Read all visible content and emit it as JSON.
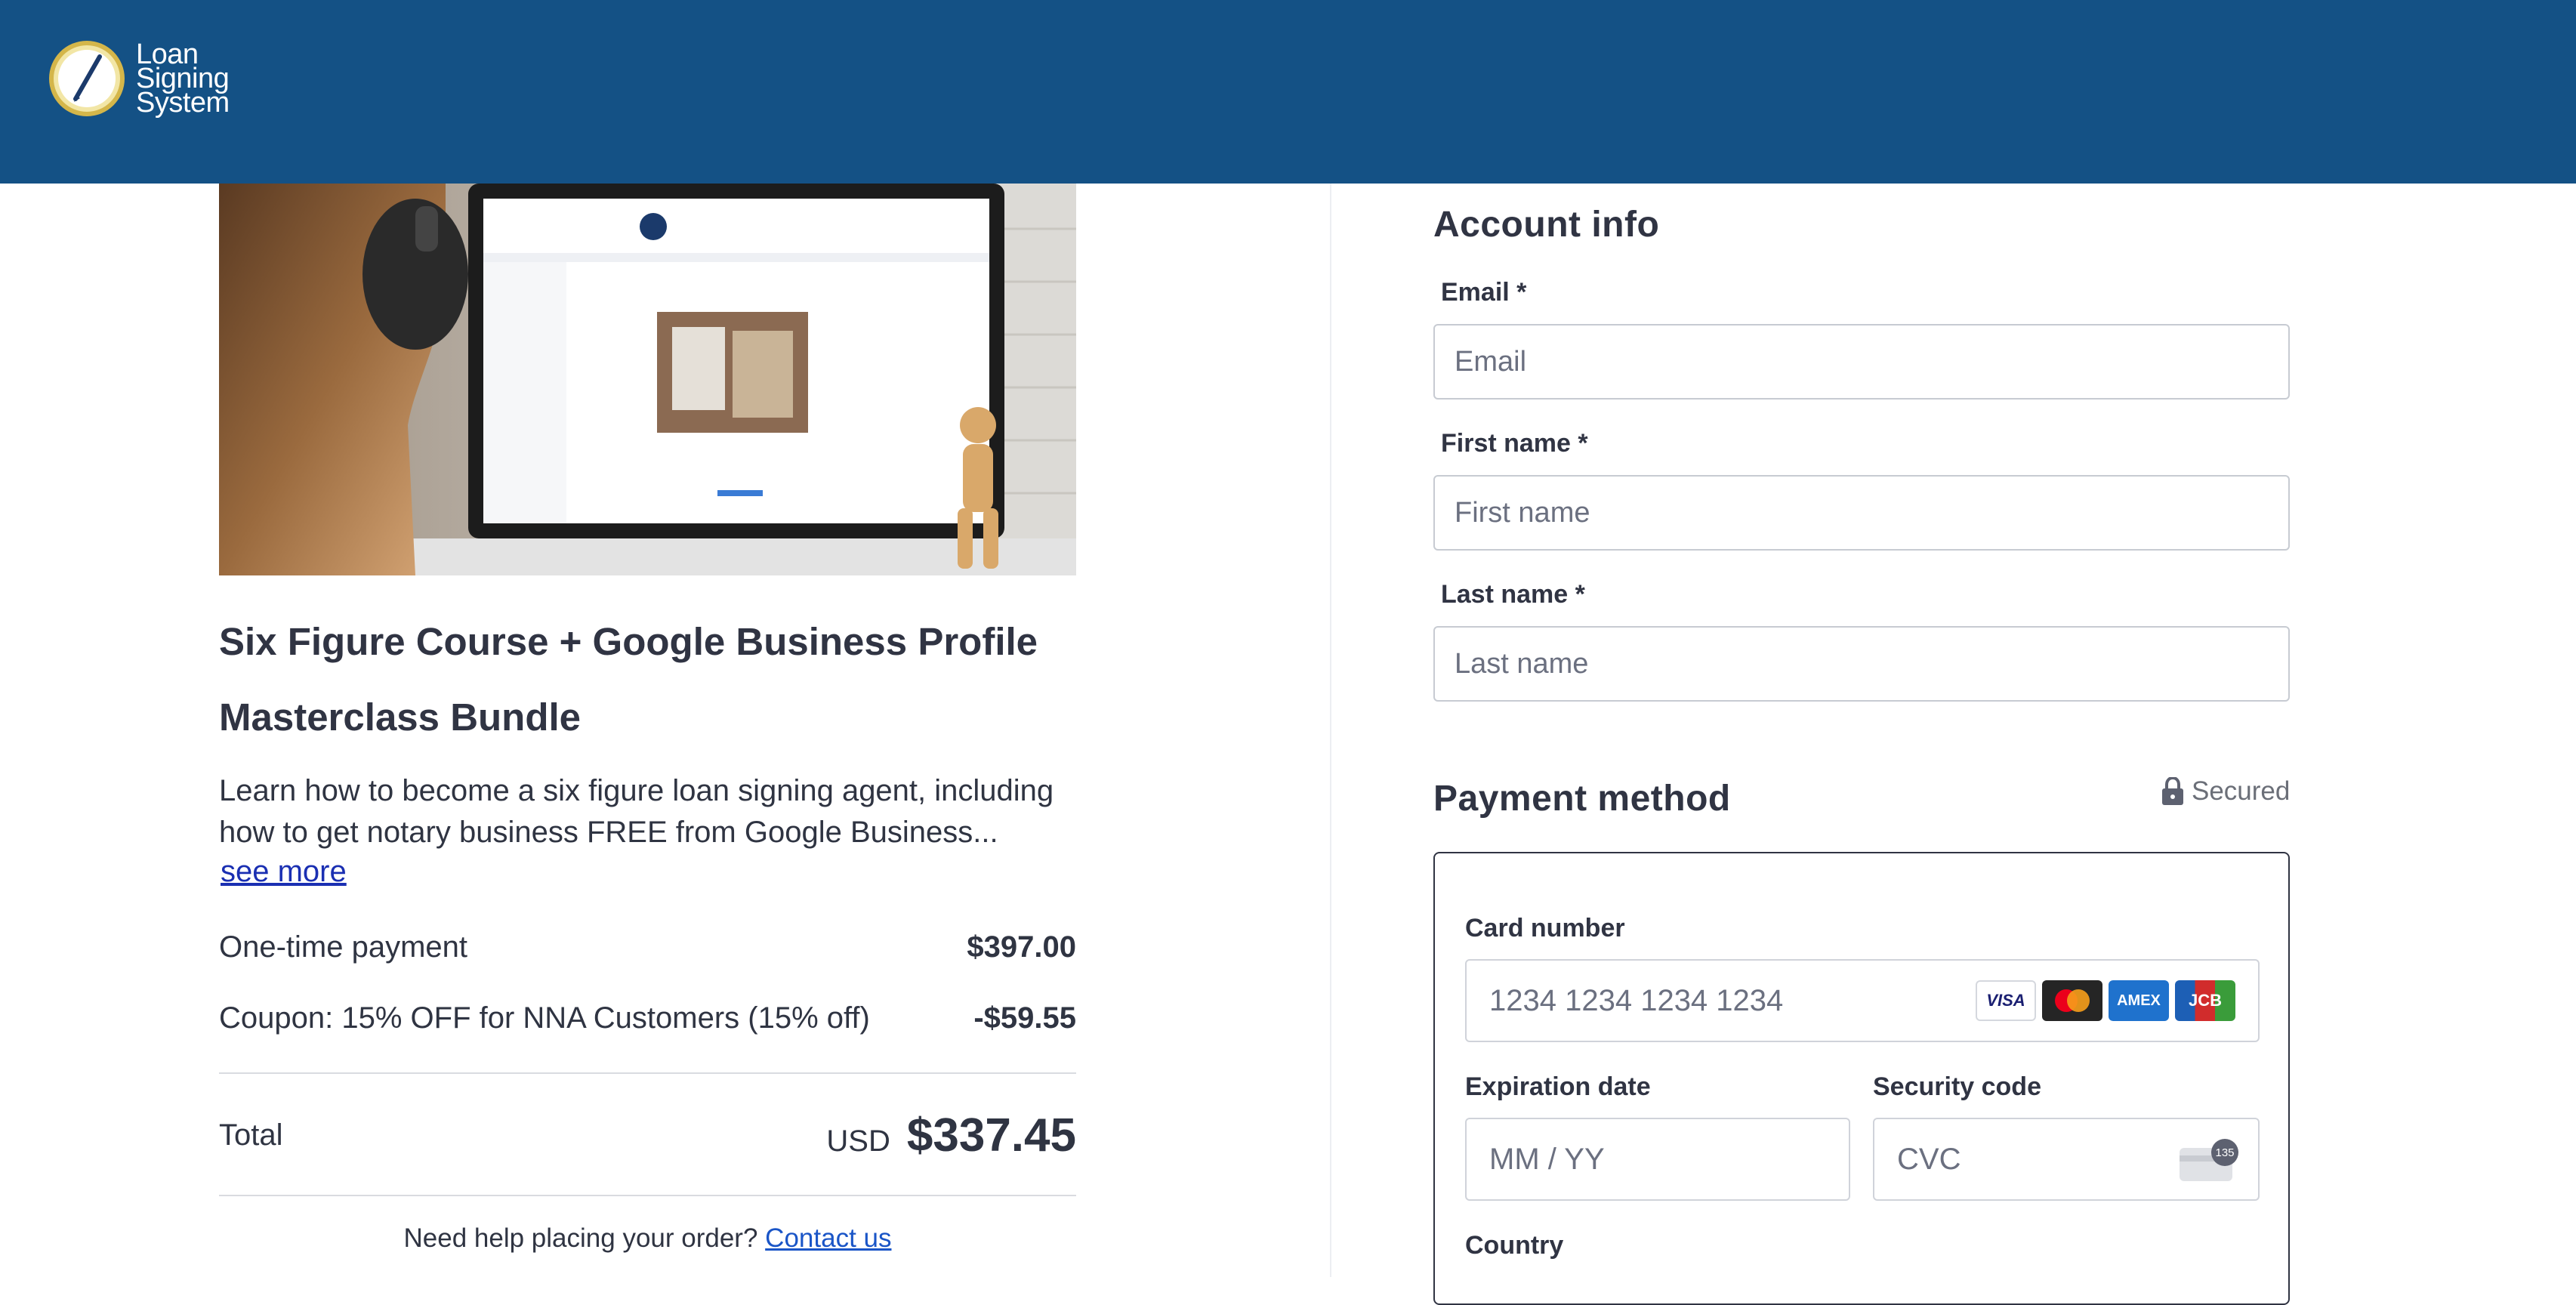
{
  "header": {
    "logo_lines": [
      "Loan",
      "Signing",
      "System"
    ],
    "brand_color": "#145185"
  },
  "product": {
    "title": "Six Figure Course + Google Business Profile Masterclass Bundle",
    "description": "Learn how to become a six figure loan signing agent, including how to get notary business FREE from Google Business...",
    "see_more": "see more",
    "image_icon": "course-preview-image"
  },
  "order": {
    "lines": [
      {
        "label": "One-time payment",
        "amount": "$397.00"
      },
      {
        "label": "Coupon: 15% OFF for NNA Customers (15% off)",
        "amount": "-$59.55"
      }
    ],
    "total_label": "Total",
    "total_currency": "USD",
    "total_amount": "$337.45",
    "help_text": "Need help placing your order?",
    "help_link": "Contact us"
  },
  "account": {
    "title": "Account info",
    "email_label": "Email *",
    "email_placeholder": "Email",
    "first_label": "First name *",
    "first_placeholder": "First name",
    "last_label": "Last name *",
    "last_placeholder": "Last name"
  },
  "payment": {
    "title": "Payment method",
    "secured": "Secured",
    "card_label": "Card number",
    "card_placeholder": "1234 1234 1234 1234",
    "card_brands": [
      "VISA",
      "mastercard",
      "AMEX",
      "JCB"
    ],
    "exp_label": "Expiration date",
    "exp_placeholder": "MM / YY",
    "cvc_label": "Security code",
    "cvc_placeholder": "CVC",
    "cvc_badge": "135",
    "country_label": "Country"
  }
}
